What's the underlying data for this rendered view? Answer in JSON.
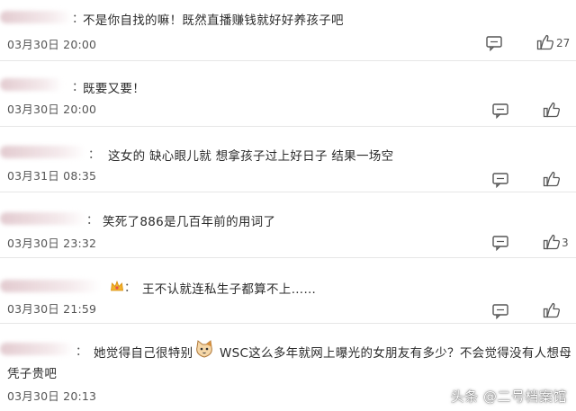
{
  "comments": [
    {
      "text": "不是你自找的嘛！既然直播赚钱就好好养孩子吧",
      "time": "03月30日 20:00",
      "likes": "27"
    },
    {
      "text": "既要又要！",
      "time": "03月30日 20:00",
      "likes": ""
    },
    {
      "text": "这女的 缺心眼儿就 想拿孩子过上好日子 结果一场空",
      "time": "03月31日 08:35",
      "likes": ""
    },
    {
      "text": "笑死了886是几百年前的用词了",
      "time": "03月30日 23:32",
      "likes": "3"
    },
    {
      "text": "王不认就连私生子都算不上……",
      "time": "03月30日 21:59",
      "likes": ""
    },
    {
      "text_a": "她觉得自己很特别",
      "text_b": "WSC这么多年就网上曝光的女朋友有多少？不会觉得没有人想母",
      "text_c": "凭子贵吧",
      "time": "03月30日 20:13",
      "likes": ""
    }
  ],
  "watermark": "头条 @二号档案馆",
  "icons": {
    "reply": "comment-icon",
    "like": "thumbs-up-icon",
    "badge": "crown-icon",
    "emoji": "cat-face-icon"
  }
}
